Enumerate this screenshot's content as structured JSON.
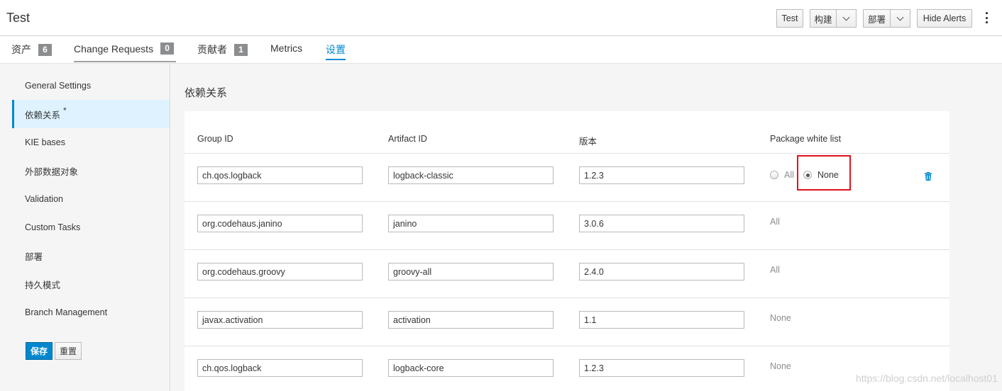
{
  "header": {
    "title": "Test",
    "buttons": {
      "test": "Test",
      "build": "构建",
      "deploy": "部署",
      "hide_alerts": "Hide Alerts"
    }
  },
  "tabs": [
    {
      "label": "资产",
      "badge": "6"
    },
    {
      "label": "Change Requests",
      "badge": "0"
    },
    {
      "label": "贡献者",
      "badge": "1"
    },
    {
      "label": "Metrics"
    },
    {
      "label": "设置",
      "active": true
    }
  ],
  "sidebar": {
    "items": [
      {
        "label": "General Settings"
      },
      {
        "label": "依赖关系",
        "modified": "*",
        "active": true
      },
      {
        "label": "KIE bases"
      },
      {
        "label": "外部数据对象"
      },
      {
        "label": "Validation"
      },
      {
        "label": "Custom Tasks"
      },
      {
        "label": "部署"
      },
      {
        "label": "持久模式"
      },
      {
        "label": "Branch Management"
      }
    ],
    "save_label": "保存",
    "reset_label": "重置"
  },
  "main": {
    "section_title": "依赖关系",
    "columns": [
      "Group ID",
      "Artifact ID",
      "版本",
      "Package white list"
    ],
    "rows": [
      {
        "group_id": "ch.qos.logback",
        "artifact_id": "logback-classic",
        "version": "1.2.3",
        "whitelist": "None",
        "whitelist_mode": "radio",
        "radio_all": "All",
        "radio_none": "None"
      },
      {
        "group_id": "org.codehaus.janino",
        "artifact_id": "janino",
        "version": "3.0.6",
        "whitelist": "All",
        "whitelist_mode": "text"
      },
      {
        "group_id": "org.codehaus.groovy",
        "artifact_id": "groovy-all",
        "version": "2.4.0",
        "whitelist": "All",
        "whitelist_mode": "text"
      },
      {
        "group_id": "javax.activation",
        "artifact_id": "activation",
        "version": "1.1",
        "whitelist": "None",
        "whitelist_mode": "text"
      },
      {
        "group_id": "ch.qos.logback",
        "artifact_id": "logback-core",
        "version": "1.2.3",
        "whitelist": "None",
        "whitelist_mode": "text"
      }
    ]
  },
  "watermark": "https://blog.csdn.net/localhost01",
  "colors": {
    "accent": "#0088ce",
    "highlight": "#e0141e",
    "badge": "#8b8d8f"
  }
}
